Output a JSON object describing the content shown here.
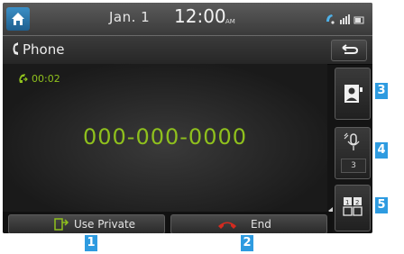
{
  "statusbar": {
    "date": "Jan.  1",
    "time": "12:00",
    "ampm": "AM"
  },
  "titlebar": {
    "title": "Phone"
  },
  "call": {
    "duration": "00:02",
    "number": "000-000-0000"
  },
  "sidebar": {
    "mute_count": "3"
  },
  "bottom": {
    "use_private_label": "Use Private",
    "end_label": "End"
  },
  "callouts": [
    "1",
    "2",
    "3",
    "4",
    "5"
  ],
  "colors": {
    "accent_green": "#8fc01d",
    "tag_blue": "#2e9be0",
    "end_red": "#d42a1f"
  }
}
